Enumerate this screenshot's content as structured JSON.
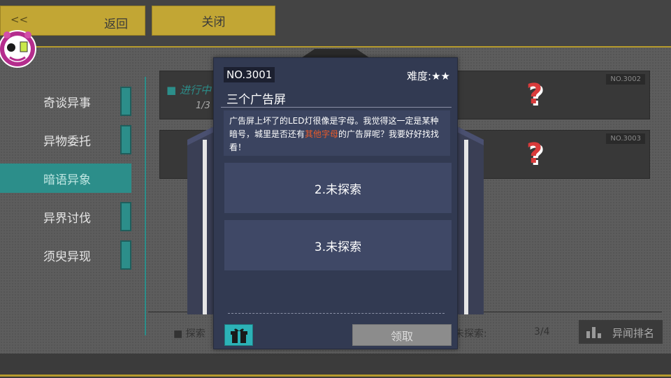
{
  "topbar": {
    "back_chevron": "<<",
    "back_label": "返回",
    "close_label": "关闭"
  },
  "menu": {
    "items": [
      {
        "label": "奇谈异事",
        "active": false
      },
      {
        "label": "异物委托",
        "active": false
      },
      {
        "label": "暗语异象",
        "active": true
      },
      {
        "label": "异界讨伐",
        "active": false
      },
      {
        "label": "须臾异现",
        "active": false
      }
    ]
  },
  "list": {
    "rows": [
      {
        "no": "NO.3002",
        "status": "进行中",
        "progress": "1/3"
      },
      {
        "no": "NO.3003"
      }
    ],
    "explore_label": "探索",
    "unexplored_label": "未探索:",
    "unexplored_value": "3/4",
    "rank_label": "异闻排名"
  },
  "dialog": {
    "no": "NO.3001",
    "difficulty_label": "难度:",
    "difficulty_stars": "★★",
    "title": "三个广告屏",
    "desc_part1": "广告屏上坏了的LED灯很像是字母。我觉得这一定是某种暗号，城里是否还有",
    "desc_highlight": "其他字母",
    "desc_part2": "的广告屏呢？我要好好找找看！",
    "clues": [
      "2.未探索",
      "3.未探索"
    ],
    "claim_label": "领取"
  },
  "colors": {
    "accent_teal": "#2c8e8a",
    "gold": "#c2a634",
    "highlight": "#e85a2a",
    "dialog_bg": "#323a52"
  },
  "icons": [
    "gift-icon",
    "rank-chart-icon",
    "question-mark-icon",
    "avatar-mascot-icon"
  ]
}
